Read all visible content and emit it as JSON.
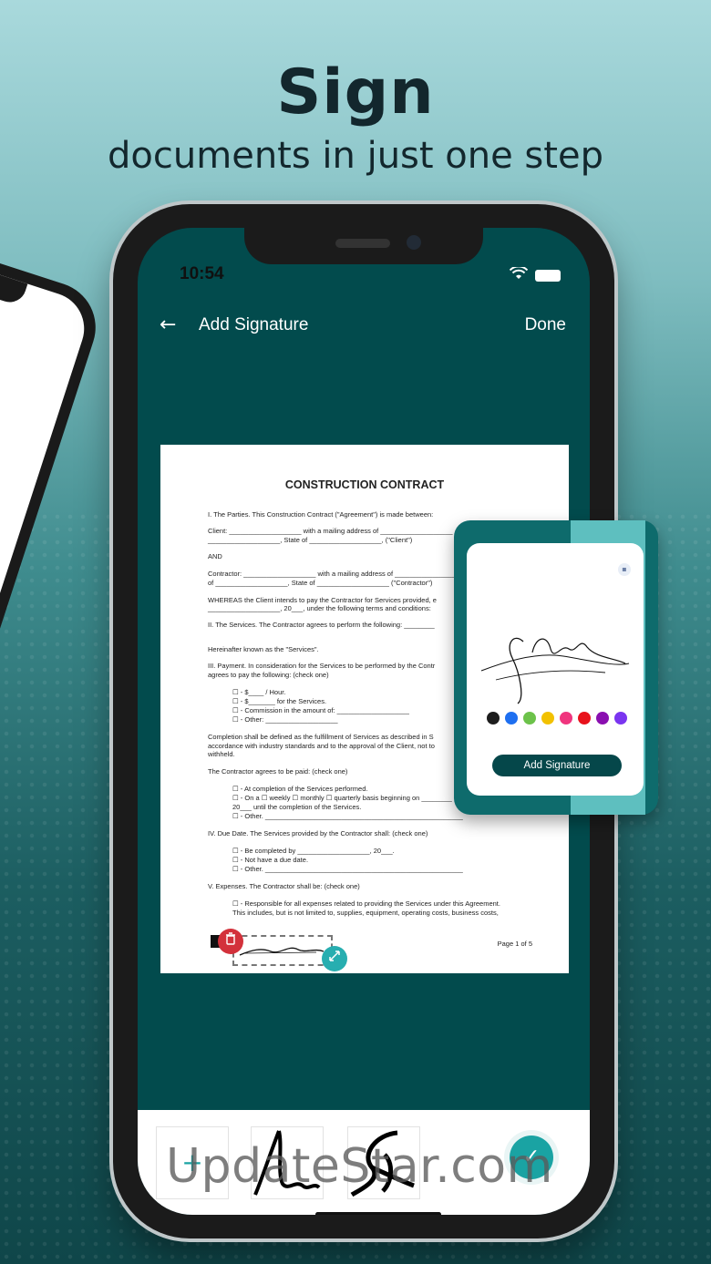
{
  "hero": {
    "title": "Sign",
    "subtitle": "documents in just one step"
  },
  "status_bar": {
    "time": "10:54",
    "wifi_icon": "wifi-icon",
    "battery_icon": "battery-icon"
  },
  "nav": {
    "back_icon": "arrow-left-icon",
    "back_glyph": "←",
    "title": "Add Signature",
    "done_label": "Done"
  },
  "document": {
    "title": "CONSTRUCTION CONTRACT",
    "lines": [
      "I. The Parties. This Construction Contract (\"Agreement\") is made between:",
      "Client: ___________________ with a mailing address of ___________________",
      "___________________, State of ___________________, (\"Client\")",
      "AND",
      "Contractor: ___________________ with a mailing address of ___________________",
      "of ___________________, State of ___________________ (\"Contractor\")",
      "WHEREAS the Client intends to pay the Contractor for Services provided, e",
      "___________________, 20___, under the following terms and conditions:",
      "II. The Services. The Contractor agrees to perform the following: ________",
      "Hereinafter known as the \"Services\".",
      "III. Payment. In consideration for the Services to be performed by the Contr",
      "agrees to pay the following: (check one)",
      "☐ - $____ / Hour.",
      "☐ - $_______ for the Services.",
      "☐ - Commission in the amount of: ___________________",
      "☐ - Other: ___________________",
      "Completion shall be defined as the fulfillment of Services as described in S",
      "accordance with industry standards and to the approval of the Client, not to",
      "withheld.",
      "The Contractor agrees to be paid: (check one)",
      "☐ - At completion of the Services performed.",
      "☐ - On a ☐ weekly ☐ monthly ☐ quarterly basis beginning on ________",
      "20___ until the completion of the Services.",
      "☐ - Other. ____________________________________________________",
      "IV. Due Date. The Services provided by the Contractor shall: (check one)",
      "☐ - Be completed by ___________________, 20___.",
      "☐ - Not have a due date.",
      "☐ - Other. ____________________________________________________",
      "V. Expenses. The Contractor shall be: (check one)",
      "☐ - Responsible for all expenses related to providing the Services under this Agreement.",
      "This includes, but is not limited to, supplies, equipment, operating costs, business costs,"
    ],
    "page_label": "Page 1 of 5",
    "delete_icon": "trash-icon",
    "resize_icon": "resize-icon"
  },
  "signature_card": {
    "clear_icon": "eraser-icon",
    "colors": [
      "#1d1d1d",
      "#1e6ff0",
      "#6cc24a",
      "#f2c100",
      "#f0357e",
      "#e8121b",
      "#8a0fb0",
      "#7a35f0"
    ],
    "button_label": "Add Signature"
  },
  "tray": {
    "add_icon": "plus-icon",
    "add_glyph": "+",
    "saved_signatures": [
      "saved-signature-1",
      "saved-signature-2"
    ],
    "confirm_icon": "check-icon",
    "confirm_glyph": "✓"
  },
  "watermark": "UpdateStar.com"
}
